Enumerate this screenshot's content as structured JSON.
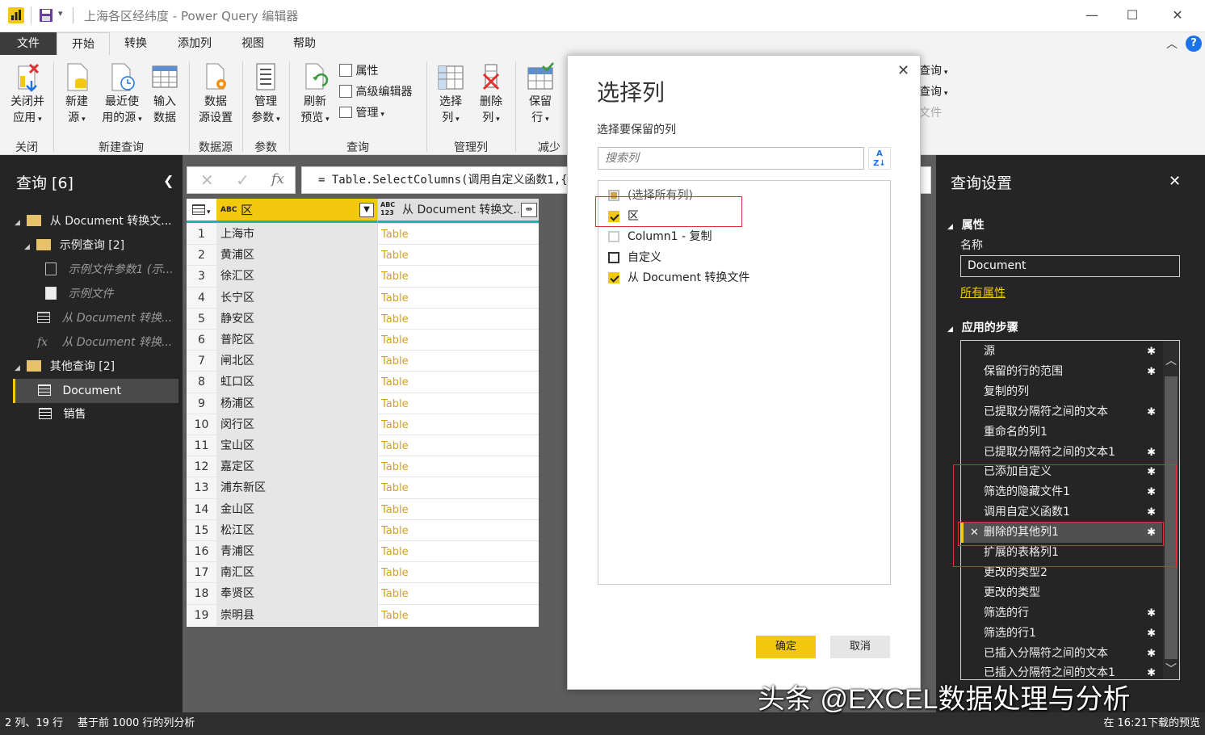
{
  "window": {
    "title": "上海各区经纬度 - Power Query 编辑器",
    "minimize_glyph": "—",
    "maximize_glyph": "☐",
    "close_glyph": "✕"
  },
  "tabs": [
    "文件",
    "开始",
    "转换",
    "添加列",
    "视图",
    "帮助"
  ],
  "ribbon": {
    "close_apply": [
      "关闭并",
      "应用"
    ],
    "new_source": [
      "新建",
      "源"
    ],
    "recent_source": [
      "最近使",
      "用的源"
    ],
    "enter_data": [
      "输入",
      "数据"
    ],
    "data_source_settings": [
      "数据",
      "源设置"
    ],
    "manage_params": [
      "管理",
      "参数"
    ],
    "refresh": [
      "刷新",
      "预览"
    ],
    "properties": "属性",
    "advanced_editor": "高级编辑器",
    "manage": "管理",
    "choose_columns": [
      "选择",
      "列"
    ],
    "remove_columns": [
      "删除",
      "列"
    ],
    "keep_rows": [
      "保留",
      "行"
    ],
    "merge_query_1": "查询",
    "merge_query_2": "查询",
    "combine_files": "文件",
    "groups": {
      "close": "关闭",
      "new_query": "新建查询",
      "data_source": "数据源",
      "params": "参数",
      "query": "查询",
      "manage_columns": "管理列",
      "reduce_rows": "减少"
    }
  },
  "queries_pane": {
    "title": "查询 [6]",
    "items": [
      {
        "label": "从 Document 转换文...",
        "kind": "folder"
      },
      {
        "label": "示例查询 [2]",
        "kind": "folder"
      },
      {
        "label": "示例文件参数1 (示...",
        "kind": "param"
      },
      {
        "label": "示例文件",
        "kind": "doc"
      },
      {
        "label": "从 Document 转换...",
        "kind": "table"
      },
      {
        "label": "从 Document 转换...",
        "kind": "fx"
      },
      {
        "label": "其他查询 [2]",
        "kind": "folder"
      },
      {
        "label": "Document",
        "kind": "table"
      },
      {
        "label": "销售",
        "kind": "table"
      }
    ]
  },
  "formula_bar": {
    "formula": "= Table.SelectColumns(调用自定义函数1,{"
  },
  "grid": {
    "col1_type": "ABC",
    "col1_header": "区",
    "col2_type_top": "ABC",
    "col2_type_bottom": "123",
    "col2_header": "从 Document 转换文...",
    "rows": [
      [
        "1",
        "上海市",
        "Table"
      ],
      [
        "2",
        "黄浦区",
        "Table"
      ],
      [
        "3",
        "徐汇区",
        "Table"
      ],
      [
        "4",
        "长宁区",
        "Table"
      ],
      [
        "5",
        "静安区",
        "Table"
      ],
      [
        "6",
        "普陀区",
        "Table"
      ],
      [
        "7",
        "闸北区",
        "Table"
      ],
      [
        "8",
        "虹口区",
        "Table"
      ],
      [
        "9",
        "杨浦区",
        "Table"
      ],
      [
        "10",
        "闵行区",
        "Table"
      ],
      [
        "11",
        "宝山区",
        "Table"
      ],
      [
        "12",
        "嘉定区",
        "Table"
      ],
      [
        "13",
        "浦东新区",
        "Table"
      ],
      [
        "14",
        "金山区",
        "Table"
      ],
      [
        "15",
        "松江区",
        "Table"
      ],
      [
        "16",
        "青浦区",
        "Table"
      ],
      [
        "17",
        "南汇区",
        "Table"
      ],
      [
        "18",
        "奉贤区",
        "Table"
      ],
      [
        "19",
        "崇明县",
        "Table"
      ]
    ]
  },
  "dialog": {
    "title": "选择列",
    "subtitle": "选择要保留的列",
    "search_placeholder": "搜索列",
    "columns": [
      {
        "label": "(选择所有列)",
        "state": "partial"
      },
      {
        "label": "区",
        "state": "checked"
      },
      {
        "label": "Column1 - 复制",
        "state": "unchecked_dim"
      },
      {
        "label": "自定义",
        "state": "unchecked"
      },
      {
        "label": "从 Document 转换文件",
        "state": "checked"
      }
    ],
    "ok": "确定",
    "cancel": "取消"
  },
  "settings_pane": {
    "title": "查询设置",
    "properties_header": "属性",
    "name_label": "名称",
    "name_value": "Document",
    "all_properties": "所有属性",
    "steps_header": "应用的步骤",
    "steps": [
      {
        "label": "源",
        "gear": true
      },
      {
        "label": "保留的行的范围",
        "gear": true
      },
      {
        "label": "复制的列",
        "gear": false
      },
      {
        "label": "已提取分隔符之间的文本",
        "gear": true
      },
      {
        "label": "重命名的列1",
        "gear": false
      },
      {
        "label": "已提取分隔符之间的文本1",
        "gear": true
      },
      {
        "label": "已添加自定义",
        "gear": true
      },
      {
        "label": "筛选的隐藏文件1",
        "gear": true
      },
      {
        "label": "调用自定义函数1",
        "gear": true
      },
      {
        "label": "删除的其他列1",
        "gear": true
      },
      {
        "label": "扩展的表格列1",
        "gear": false
      },
      {
        "label": "更改的类型2",
        "gear": false
      },
      {
        "label": "更改的类型",
        "gear": false
      },
      {
        "label": "筛选的行",
        "gear": true
      },
      {
        "label": "筛选的行1",
        "gear": true
      },
      {
        "label": "已插入分隔符之间的文本",
        "gear": true
      },
      {
        "label": "已插入分隔符之间的文本1",
        "gear": true
      }
    ],
    "selected_step": 9
  },
  "status": {
    "left": "2 列、19 行",
    "profile": "基于前 1000 行的列分析",
    "right": "在 16:21下载的预览"
  },
  "watermark": "头条 @EXCEL数据处理与分析",
  "colors": {
    "accent_yellow": "#f2c811",
    "dark_pane": "#252526",
    "highlight_red": "#e03030"
  }
}
